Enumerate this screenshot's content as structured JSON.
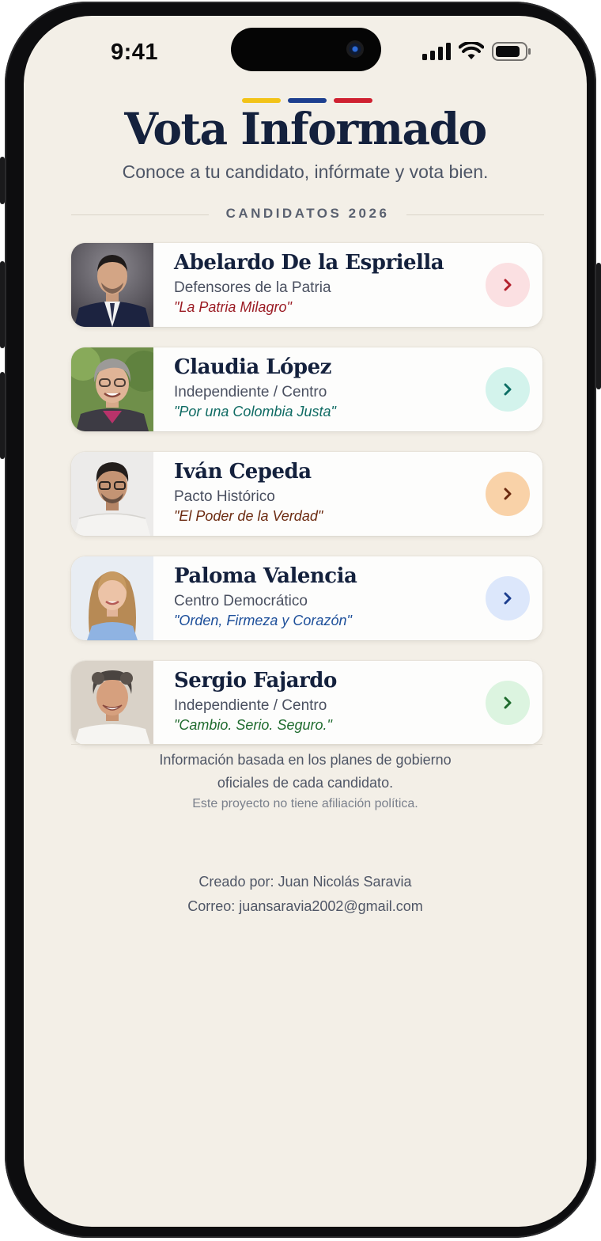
{
  "status_bar": {
    "time": "9:41"
  },
  "header": {
    "title": "Vota Informado",
    "subtitle": "Conoce a tu candidato, infórmate y vota bien.",
    "flag_colors": [
      "#f2c318",
      "#1d3f8f",
      "#cf2030"
    ]
  },
  "section": {
    "label": "CANDIDATOS 2026"
  },
  "candidates": [
    {
      "name": "Abelardo De la Espriella",
      "party": "Defensores de la Patria",
      "slogan": "\"La Patria Milagro\"",
      "slogan_color": "#9b1c24",
      "arrow_bg": "#fbe0e2",
      "arrow_color": "#b3202d",
      "photo": "man-dark-suit"
    },
    {
      "name": "Claudia López",
      "party": "Independiente / Centro",
      "slogan": "\"Por una Colombia Justa\"",
      "slogan_color": "#0f6b63",
      "arrow_bg": "#d3f3ec",
      "arrow_color": "#0e6f66",
      "photo": "woman-grey-hair-glasses"
    },
    {
      "name": "Iván Cepeda",
      "party": "Pacto Histórico",
      "slogan": "\"El Poder de la Verdad\"",
      "slogan_color": "#6b2a10",
      "arrow_bg": "#f9d2a8",
      "arrow_color": "#6b2a10",
      "photo": "man-glasses-white-shirt"
    },
    {
      "name": "Paloma Valencia",
      "party": "Centro Democrático",
      "slogan": "\"Orden, Firmeza y Corazón\"",
      "slogan_color": "#1d4f9a",
      "arrow_bg": "#dce7fb",
      "arrow_color": "#1d3f8f",
      "photo": "woman-long-hair"
    },
    {
      "name": "Sergio Fajardo",
      "party": "Independiente / Centro",
      "slogan": "\"Cambio. Serio. Seguro.\"",
      "slogan_color": "#1f6b2e",
      "arrow_bg": "#dcf4e0",
      "arrow_color": "#1f6b2e",
      "photo": "man-curly-grey-hair"
    }
  ],
  "footer": {
    "info_line1": "Información basada en los planes de gobierno",
    "info_line2": "oficiales de cada candidato.",
    "disclaimer": "Este proyecto no tiene afiliación política.",
    "credit": "Creado por: Juan Nicolás Saravia",
    "email": "Correo: juansaravia2002@gmail.com"
  },
  "icons": [
    "signal-icon",
    "wifi-icon",
    "battery-icon",
    "chevron-right-icon"
  ]
}
